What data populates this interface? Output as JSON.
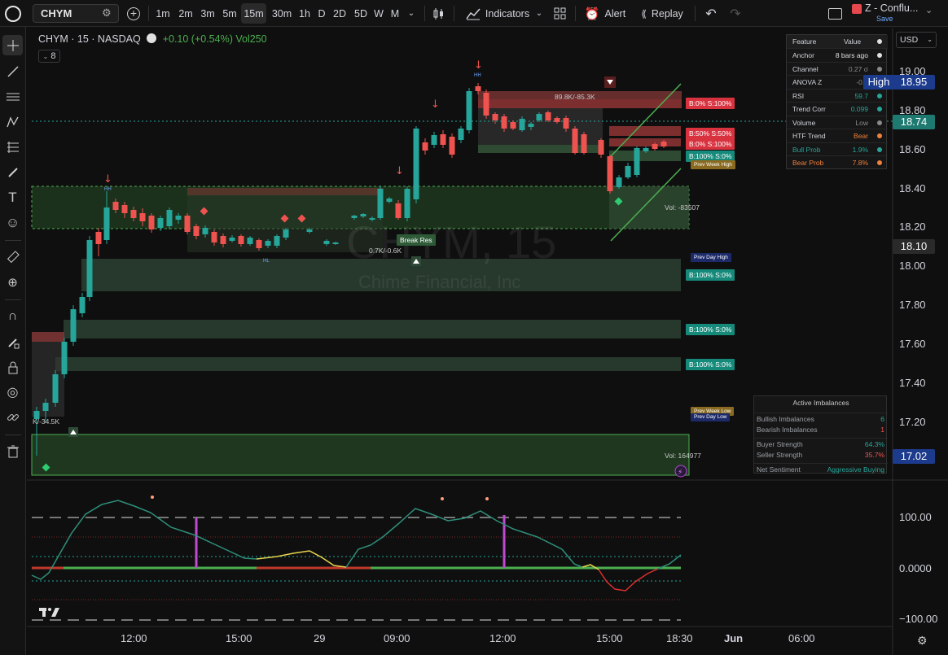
{
  "topbar": {
    "symbol": "CHYM",
    "timeframes": [
      "1m",
      "2m",
      "3m",
      "5m",
      "15m",
      "30m",
      "1h",
      "D",
      "2D",
      "5D",
      "W",
      "M"
    ],
    "active_timeframe": "15m",
    "indicators_label": "Indicators",
    "alert_label": "Alert",
    "replay_label": "Replay",
    "layout_name": "Z - Conflu...",
    "save_label": "Save"
  },
  "legend": {
    "title": "CHYM · 15 · NASDAQ",
    "change": "+0.10 (+0.54%)",
    "volume_label": "Vol",
    "volume_value": "250",
    "indicator_count": "8"
  },
  "watermark": {
    "symbol": "CHYM, 15",
    "name": "Chime Financial, Inc"
  },
  "currency": "USD",
  "price_axis": [
    "19.00",
    "18.80",
    "18.60",
    "18.40",
    "18.20",
    "18.00",
    "17.80",
    "17.60",
    "17.40",
    "17.20"
  ],
  "price_tags": {
    "high_label": "High",
    "high_value": "18.95",
    "last": "18.74",
    "level_1": "18.10",
    "level_2": "17.02"
  },
  "oscillator_axis": [
    "100.00",
    "0.0000",
    "−100.00"
  ],
  "time_axis": [
    "12:00",
    "15:00",
    "29",
    "09:00",
    "12:00",
    "15:00",
    "18:30",
    "Jun",
    "06:00"
  ],
  "feature_table": {
    "header": [
      "Feature",
      "Value"
    ],
    "rows": [
      {
        "name": "Anchor",
        "value": "8 bars ago",
        "color": "#e0e0e0"
      },
      {
        "name": "Channel",
        "value": "0.27 σ",
        "color": "#8a8a8a"
      },
      {
        "name": "ANOVA Z",
        "value": "-0.9",
        "color": "#8a8a8a"
      },
      {
        "name": "RSI",
        "value": "59.7",
        "color": "#26a69a"
      },
      {
        "name": "Trend Corr",
        "value": "0.099",
        "color": "#26a69a"
      },
      {
        "name": "Volume",
        "value": "Low",
        "color": "#8a8a8a"
      },
      {
        "name": "HTF Trend",
        "value": "Bear",
        "color": "#f0803c"
      },
      {
        "name": "Bull Prob",
        "value": "1.9%",
        "color": "#26a69a"
      },
      {
        "name": "Bear Prob",
        "value": "7.8%",
        "color": "#f0803c"
      }
    ]
  },
  "imbalance_table": {
    "title": "Active Imbalances",
    "bullish_label": "Bullish Imbalances",
    "bullish_value": "6",
    "bearish_label": "Bearish Imbalances",
    "bearish_value": "1",
    "buyer_label": "Buyer Strength",
    "buyer_value": "64.3%",
    "seller_label": "Seller Strength",
    "seller_value": "35.7%",
    "sentiment_label": "Net Sentiment",
    "sentiment_value": "Aggressive Buying"
  },
  "box_labels": {
    "b0_s100_a": "B:0% S:100%",
    "b50_s50": "B:50% S:50%",
    "b0_s100_b": "B:0% S:100%",
    "b100_s0_a": "B:100% S:0%",
    "b100_s0_b": "B:100% S:0%",
    "b100_s0_c": "B:100% S:0%",
    "b100_s0_d": "B:100% S:0%",
    "prev_week_high": "Prev Week High",
    "prev_day_high": "Prev Day High",
    "prev_week_low": "Prev Week Low",
    "prev_day_low": "Prev Day Low",
    "break_res": "Break Res",
    "vol_top": "Vol: -83507",
    "vol_bottom": "Vol: 164977",
    "delta_top": "89.8K/-85.3K",
    "delta_mid": "0.7K/-0.6K",
    "delta_left": "K/-34.5K",
    "hh": "HH",
    "hl": "HL"
  },
  "colors": {
    "bull": "#26a69a",
    "bear": "#ef5350",
    "accent": "#2962ff"
  }
}
